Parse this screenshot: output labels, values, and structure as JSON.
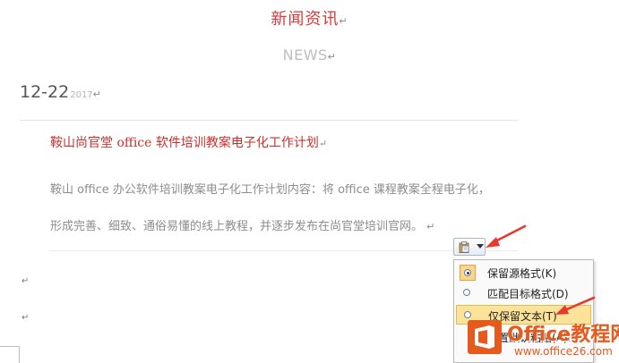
{
  "document": {
    "title_cn": "新闻资讯",
    "title_en": "NEWS",
    "para_mark": "↵",
    "date": {
      "main": "12-22",
      "year": "2017"
    },
    "article": {
      "heading": "鞍山尚官堂 office 软件培训教案电子化工作计划",
      "line1": "鞍山 office 办公软件培训教案电子化工作计划内容：将 office 课程教案全程电子化，",
      "line2": "形成完善、细致、通俗易懂的线上教程，并逐步发布在尚官堂培训官网。"
    }
  },
  "paste_options": {
    "menu": [
      {
        "label": "保留源格式(K)",
        "selected": true,
        "highlighted": false
      },
      {
        "label": "匹配目标格式(D)",
        "selected": false,
        "highlighted": false
      },
      {
        "label": "仅保留文本(T)",
        "selected": false,
        "highlighted": true
      },
      {
        "label": "设置默认粘贴(A)...",
        "selected": false,
        "highlighted": false
      }
    ]
  },
  "watermark": {
    "brand": "Office教程网",
    "url": "www.office26.com"
  },
  "colors": {
    "title_red": "#d63a3a",
    "arrow_red": "#e8392f",
    "menu_highlight": "#fde39a",
    "logo_orange": "#e55a1d"
  }
}
